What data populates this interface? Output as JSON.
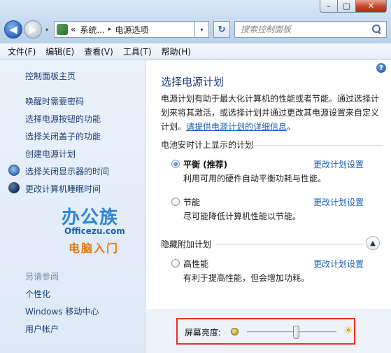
{
  "window": {
    "caption_min": "–",
    "caption_max": "□",
    "caption_close": "✕"
  },
  "nav": {
    "back_glyph": "◀",
    "fwd_glyph": "▶",
    "drop_glyph": "▾",
    "address": {
      "prefix": "«",
      "crumbs": [
        "系统...",
        "电源选项"
      ],
      "separator": "▸"
    },
    "refresh_glyph": "↻",
    "search_placeholder": "搜索控制面板"
  },
  "menubar": {
    "items": [
      "文件(F)",
      "编辑(E)",
      "查看(V)",
      "工具(T)",
      "帮助(H)"
    ]
  },
  "sidebar": {
    "home": "控制面板主页",
    "links": [
      "唤醒时需要密码",
      "选择电源按钮的功能",
      "选择关闭盖子的功能",
      "创建电源计划",
      "选择关闭显示器的时间",
      "更改计算机睡眠时间"
    ],
    "see_also_title": "另请参阅",
    "see_also": [
      "个性化",
      "Windows 移动中心",
      "用户帐户"
    ],
    "icons": {
      "display_off": "monitor-icon",
      "sleep": "moon-icon"
    }
  },
  "logo": {
    "line1": "办公族",
    "line2": "Officezu.com",
    "line3": "电脑入门"
  },
  "main": {
    "help_glyph": "?",
    "title": "选择电源计划",
    "description": "电源计划有助于最大化计算机的性能或者节能。通过选择计划来将其激活，或选择计划并通过更改其电源设置来自定义计划。",
    "description_link": "请提供电源计划的详细信息",
    "description_end": "。",
    "battery_section": "电池安时计上显示的计划",
    "plans": [
      {
        "name": "平衡 (推荐)",
        "desc": "利用可用的硬件自动平衡功耗与性能。",
        "change": "更改计划设置",
        "selected": true
      },
      {
        "name": "节能",
        "desc": "尽可能降低计算机性能以节能。",
        "change": "更改计划设置",
        "selected": false
      }
    ],
    "hidden_section": "隐藏附加计划",
    "collapse_glyph": "▲",
    "hidden_plans": [
      {
        "name": "高性能",
        "desc": "有利于提高性能，但会增加功耗。",
        "change": "更改计划设置",
        "selected": false
      }
    ]
  },
  "footer": {
    "brightness_label": "屏幕亮度:",
    "brightness_value": 0.55,
    "bright_icon": "☀",
    "highlight_color": "#e8312a"
  }
}
